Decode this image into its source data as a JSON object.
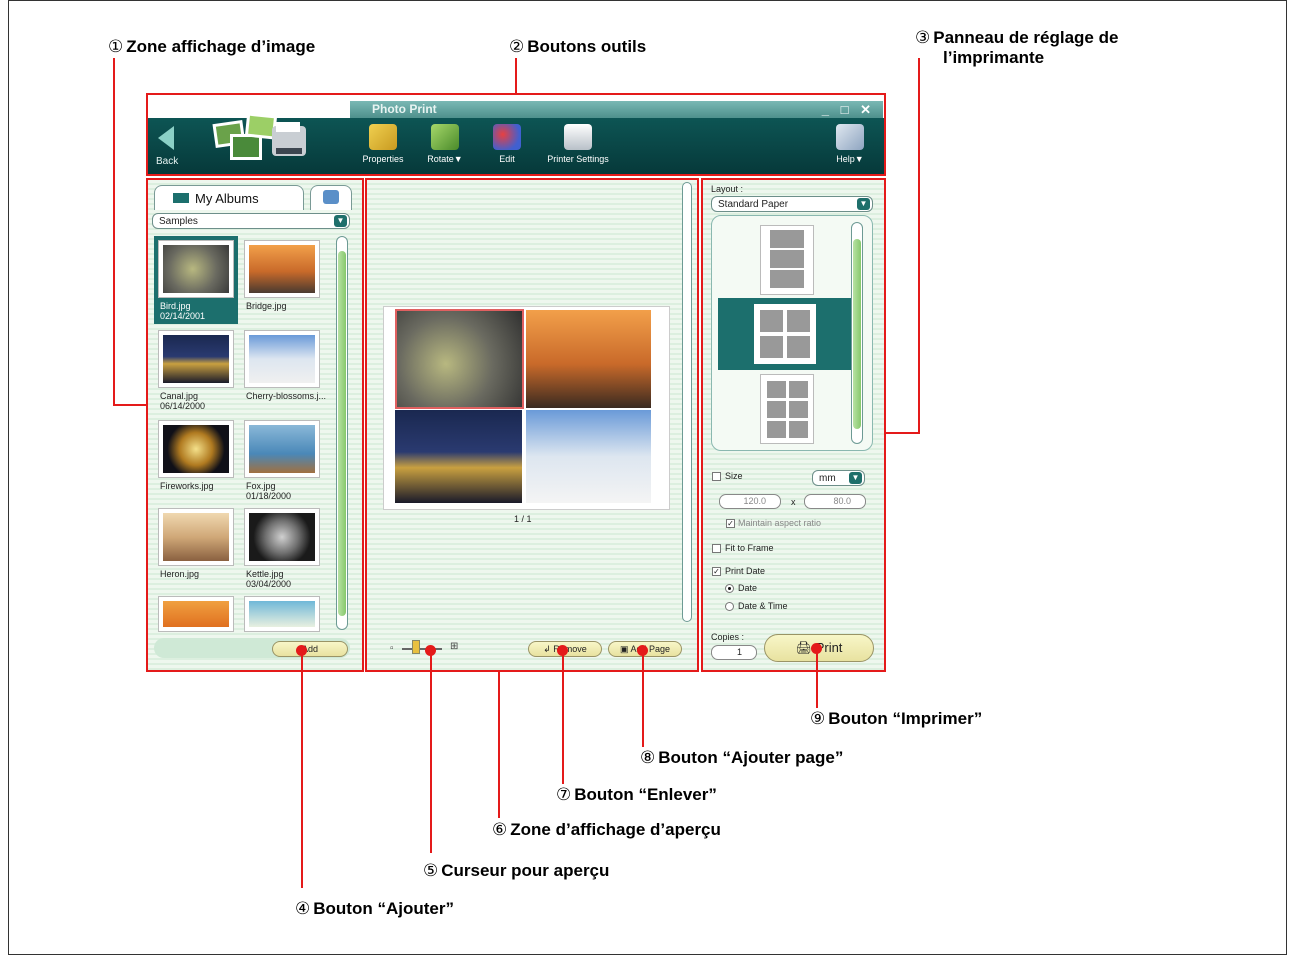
{
  "callouts": {
    "c1": {
      "num": "①",
      "text": "Zone affichage d’image"
    },
    "c2": {
      "num": "②",
      "text": "Boutons outils"
    },
    "c3": {
      "num": "③",
      "text": "Panneau de réglage de",
      "text2": "l’imprimante"
    },
    "c4": {
      "num": "④",
      "text": "Bouton “Ajouter”"
    },
    "c5": {
      "num": "⑤",
      "text": "Curseur pour aperçu"
    },
    "c6": {
      "num": "⑥",
      "text": "Zone d’affichage d’aperçu"
    },
    "c7": {
      "num": "⑦",
      "text": "Bouton “Enlever”"
    },
    "c8": {
      "num": "⑧",
      "text": "Bouton “Ajouter page”"
    },
    "c9": {
      "num": "⑨",
      "text": "Bouton “Imprimer”"
    }
  },
  "window": {
    "title": "Photo Print",
    "controls": "_ □ ✕"
  },
  "toolbar": {
    "back": "Back",
    "properties": "Properties",
    "rotate": "Rotate▼",
    "edit": "Edit",
    "printer_settings": "Printer Settings",
    "help": "Help▼"
  },
  "left_panel": {
    "tab_label": "My Albums",
    "album_select": "Samples",
    "add_button": "Add",
    "thumbnails": [
      {
        "label": "Bird.jpg\n02/14/2001"
      },
      {
        "label": "Bridge.jpg"
      },
      {
        "label": "Canal.jpg\n06/14/2000"
      },
      {
        "label": "Cherry-blossoms.j..."
      },
      {
        "label": "Fireworks.jpg"
      },
      {
        "label": "Fox.jpg\n01/18/2000"
      },
      {
        "label": "Heron.jpg"
      },
      {
        "label": "Kettle.jpg\n03/04/2000"
      }
    ]
  },
  "preview": {
    "page_indicator": "1 / 1",
    "remove_button": "Remove",
    "add_page_button": "Add Page"
  },
  "printer_panel": {
    "layout_label": "Layout :",
    "paper_select": "Standard Paper",
    "size_label": "Size",
    "unit_select": "mm",
    "width_value": "120.0",
    "times": "x",
    "height_value": "80.0",
    "maintain_ratio": "Maintain aspect ratio",
    "fit_to_frame": "Fit to Frame",
    "print_date": "Print Date",
    "date_option": "Date",
    "date_time_option": "Date & Time",
    "copies_label": "Copies :",
    "copies_value": "1",
    "print_button": "Print"
  },
  "colors": {
    "accent": "#e41a1a",
    "toolbar": "#0d5554",
    "panel_teal": "#1c6f6d"
  }
}
